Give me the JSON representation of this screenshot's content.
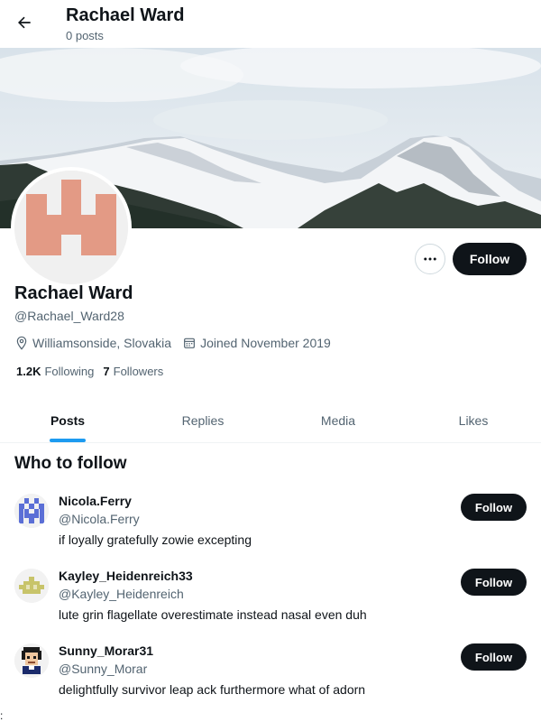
{
  "header": {
    "title": "Rachael Ward",
    "subtitle": "0 posts",
    "back_icon": "arrow-left-icon"
  },
  "profile": {
    "display_name": "Rachael Ward",
    "handle": "@Rachael_Ward28",
    "location": "Williamsonside, Slovakia",
    "joined": "Joined November 2019",
    "following_count": "1.2K",
    "following_label": "Following",
    "followers_count": "7",
    "followers_label": "Followers",
    "follow_label": "Follow",
    "more_icon": "more-horizontal-icon",
    "avatar_color": "#e39a85"
  },
  "tabs": [
    {
      "label": "Posts",
      "active": true
    },
    {
      "label": "Replies",
      "active": false
    },
    {
      "label": "Media",
      "active": false
    },
    {
      "label": "Likes",
      "active": false
    }
  ],
  "who_to_follow": {
    "title": "Who to follow",
    "items": [
      {
        "name": "Nicola.Ferry",
        "handle": "@Nicola.Ferry",
        "bio": "if loyally gratefully zowie excepting",
        "follow_label": "Follow",
        "avatar_color": "#5b6fd6"
      },
      {
        "name": "Kayley_Heidenreich33",
        "handle": "@Kayley_Heidenreich",
        "bio": "lute grin flagellate overestimate instead nasal even duh",
        "follow_label": "Follow",
        "avatar_color": "#c8c46a"
      },
      {
        "name": "Sunny_Morar31",
        "handle": "@Sunny_Morar",
        "bio": "delightfully survivor leap ack furthermore what of adorn",
        "follow_label": "Follow",
        "avatar_color": "#1b2b6b"
      }
    ]
  },
  "stray_char": ":",
  "colors": {
    "accent": "#1d9bf0",
    "button": "#0f1419",
    "secondary_text": "#536471"
  }
}
